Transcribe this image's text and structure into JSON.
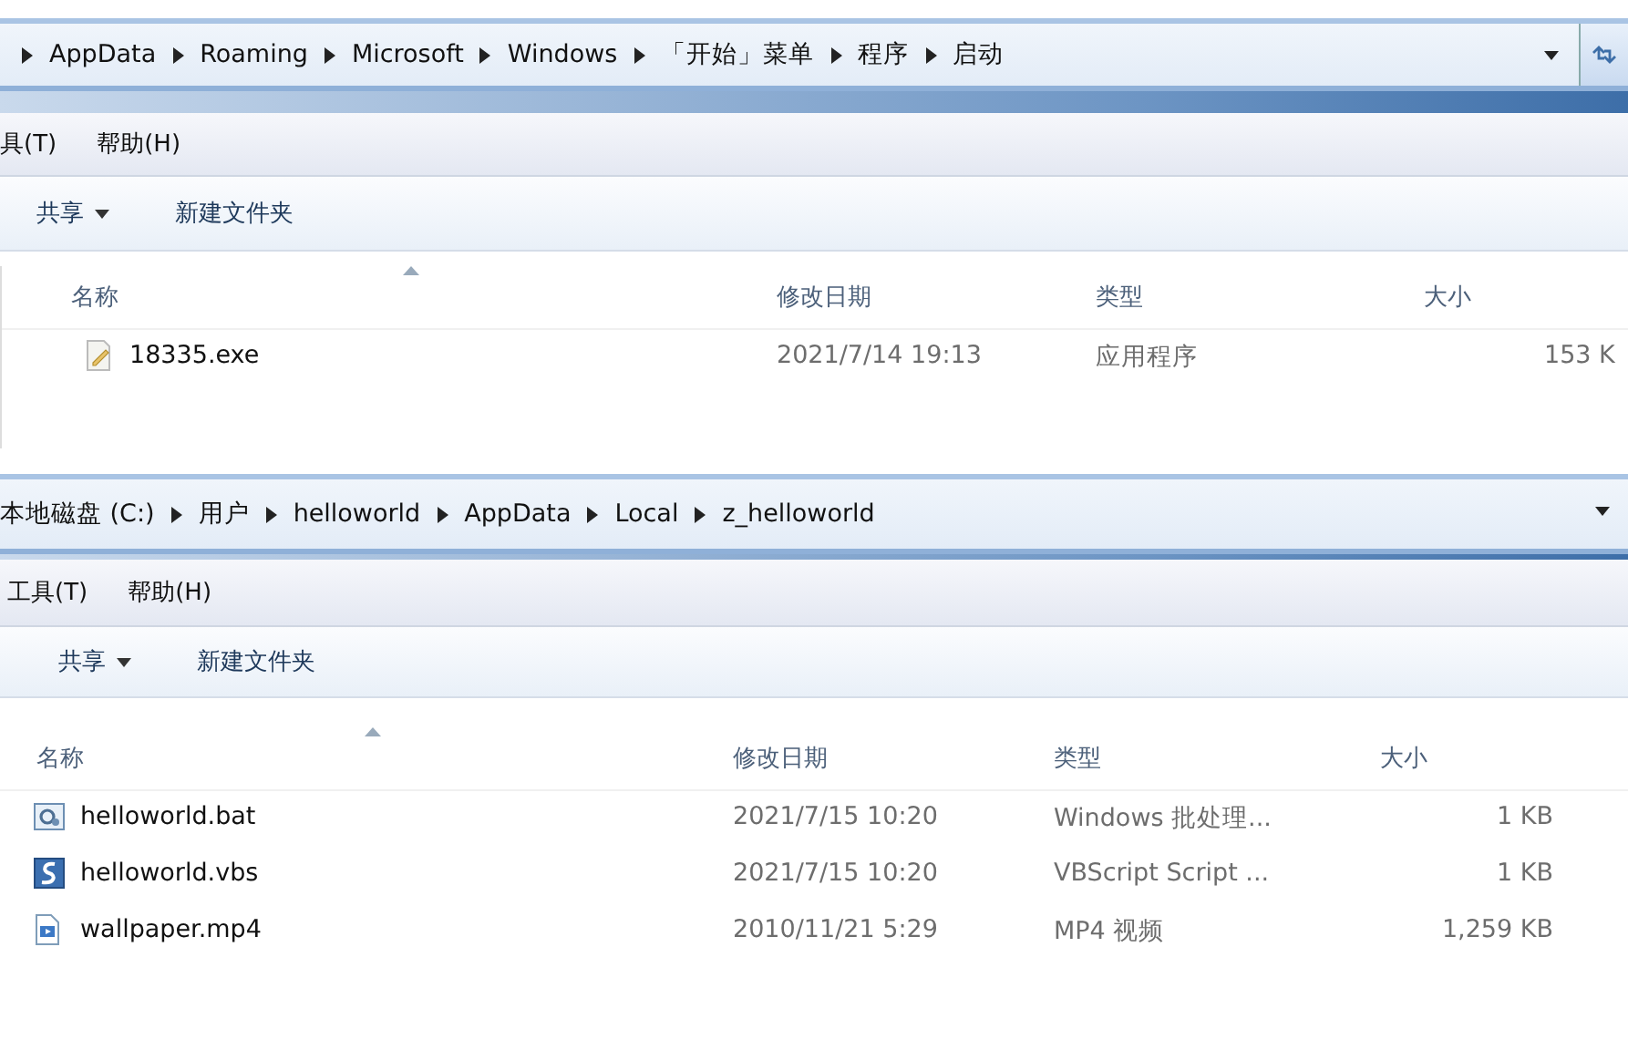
{
  "panels": [
    {
      "leading_separator": true,
      "breadcrumb": [
        "AppData",
        "Roaming",
        "Microsoft",
        "Windows",
        "「开始」菜单",
        "程序",
        "启动"
      ],
      "refresh_button": true,
      "menu": [
        "具(T)",
        "帮助(H)"
      ],
      "toolbar": [
        {
          "label": "共享",
          "dropdown": true
        },
        {
          "label": "新建文件夹",
          "dropdown": false
        }
      ],
      "columns": [
        "名称",
        "修改日期",
        "类型",
        "大小"
      ],
      "rows": [
        {
          "kind": "exe",
          "name": "18335.exe",
          "date": "2021/7/14 19:13",
          "type": "应用程序",
          "size": "153 K"
        }
      ]
    },
    {
      "leading_separator": false,
      "breadcrumb": [
        "本地磁盘 (C:)",
        "用户",
        "helloworld",
        "AppData",
        "Local",
        "z_helloworld"
      ],
      "refresh_button": false,
      "menu": [
        "工具(T)",
        "帮助(H)"
      ],
      "toolbar": [
        {
          "label": "共享",
          "dropdown": true
        },
        {
          "label": "新建文件夹",
          "dropdown": false
        }
      ],
      "columns": [
        "名称",
        "修改日期",
        "类型",
        "大小"
      ],
      "rows": [
        {
          "kind": "bat",
          "name": "helloworld.bat",
          "date": "2021/7/15 10:20",
          "type": "Windows 批处理...",
          "size": "1 KB"
        },
        {
          "kind": "vbs",
          "name": "helloworld.vbs",
          "date": "2021/7/15 10:20",
          "type": "VBScript Script ...",
          "size": "1 KB"
        },
        {
          "kind": "video",
          "name": "wallpaper.mp4",
          "date": "2010/11/21 5:29",
          "type": "MP4 视频",
          "size": "1,259 KB"
        }
      ]
    }
  ]
}
